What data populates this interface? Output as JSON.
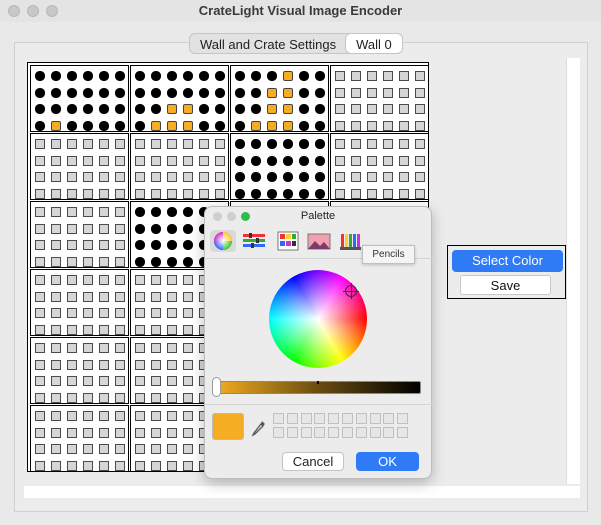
{
  "window": {
    "title": "CrateLight Visual Image Encoder"
  },
  "tabs": [
    {
      "label": "Wall and Crate Settings",
      "selected": false
    },
    {
      "label": "Wall 0",
      "selected": true
    }
  ],
  "side_panel": {
    "select_color_label": "Select Color",
    "save_label": "Save"
  },
  "palette": {
    "title": "Palette",
    "tooltip": "Pencils",
    "cancel_label": "Cancel",
    "ok_label": "OK",
    "current_color": "#f5ad24",
    "tools": [
      "color-wheel-icon",
      "color-sliders-icon",
      "color-palettes-icon",
      "image-palettes-icon",
      "pencils-icon"
    ]
  },
  "colors": {
    "accent": "#2f7bf5",
    "led_off": "#d6d6d6",
    "led_black": "#000000",
    "led_orange": "#f5ad24"
  },
  "crate_grid": {
    "rows": 6,
    "cols": 4,
    "leds_per_crate_rows": 4,
    "leds_per_crate_cols": 6
  }
}
